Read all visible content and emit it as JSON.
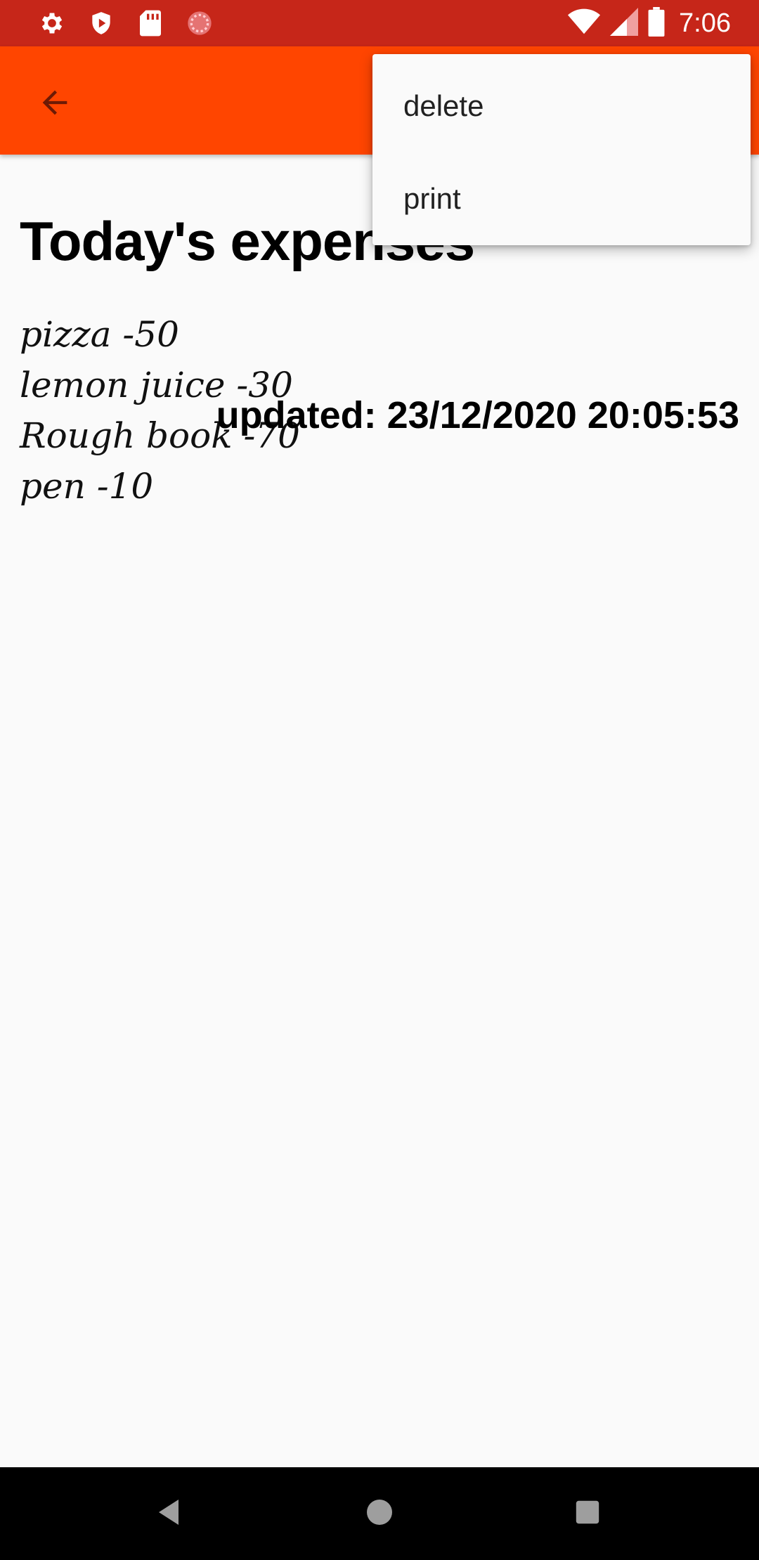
{
  "status_bar": {
    "time": "7:06",
    "left_icons": [
      "gear-icon",
      "shield-play-icon",
      "sd-card-icon",
      "sync-icon"
    ],
    "right_icons": [
      "wifi-icon",
      "signal-icon",
      "battery-icon"
    ]
  },
  "app_bar": {
    "color": "#ff4500",
    "back_icon": "arrow-back-icon"
  },
  "page": {
    "title": "Today's expenses",
    "items": [
      "pizza -50",
      "lemon juice -30",
      "Rough book -70",
      "pen -10"
    ],
    "updated": "updated: 23/12/2020 20:05:53"
  },
  "menu": {
    "items": [
      "delete",
      "print"
    ]
  },
  "nav_bar": {
    "icons": [
      "back-triangle-icon",
      "home-circle-icon",
      "recents-square-icon"
    ]
  }
}
